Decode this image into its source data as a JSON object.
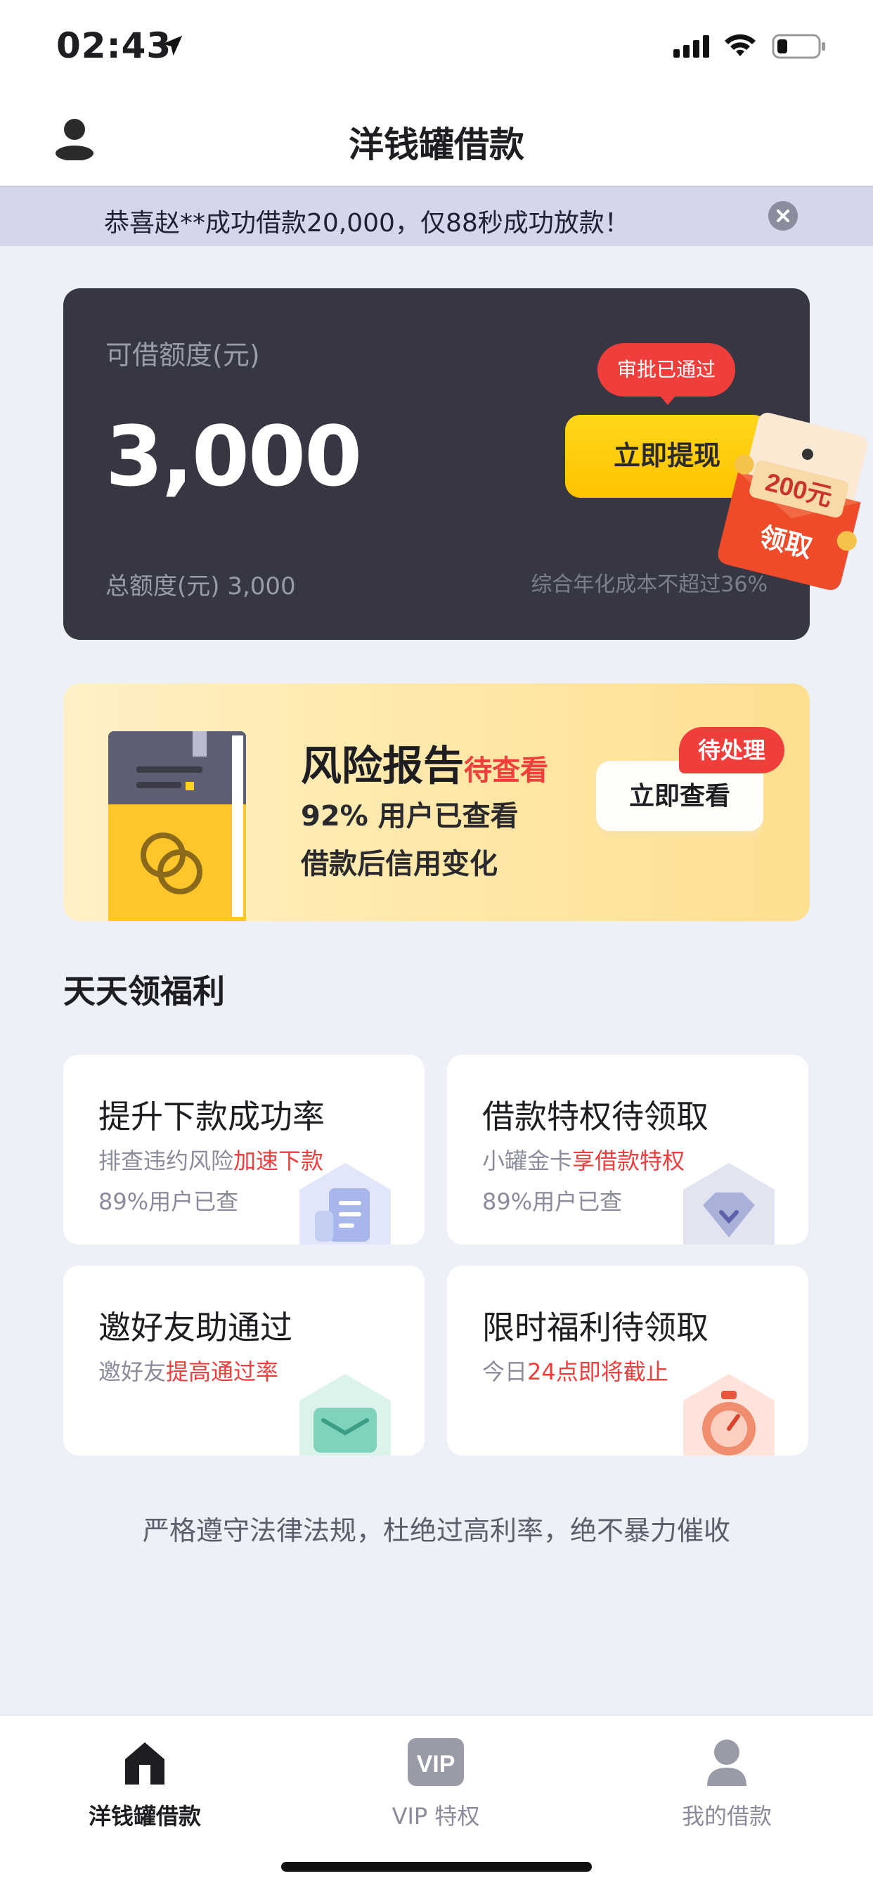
{
  "status_bar": {
    "time": "02:43"
  },
  "header": {
    "title": "洋钱罐借款"
  },
  "notice": {
    "text": "恭喜赵**成功借款20,000，仅88秒成功放款！"
  },
  "credit": {
    "label": "可借额度(元)",
    "amount": "3,000",
    "total_label": "总额度(元) 3,000",
    "rate_note": "综合年化成本不超过36%",
    "approval_badge": "审批已通过",
    "withdraw_button": "立即提现",
    "coupon_amount": "200元",
    "coupon_action": "领取"
  },
  "risk_report": {
    "title": "风险报告",
    "status": "待查看",
    "line1": "92% 用户已查看",
    "line2": "借款后信用变化",
    "button": "立即查看",
    "tag": "待处理"
  },
  "welfare": {
    "section_title": "天天领福利",
    "tiles": [
      {
        "title": "提升下款成功率",
        "sub_plain": "排查违约风险",
        "sub_highlight": "加速下款",
        "sub2": "89%用户已查",
        "icon": "document-icon"
      },
      {
        "title": "借款特权待领取",
        "sub_plain": "小罐金卡",
        "sub_highlight": "享借款特权",
        "sub2": "89%用户已查",
        "icon": "diamond-icon"
      },
      {
        "title": "邀好友助通过",
        "sub_plain": "邀好友",
        "sub_highlight": "提高通过率",
        "sub2": "",
        "icon": "envelope-icon"
      },
      {
        "title": "限时福利待领取",
        "sub_plain": "今日",
        "sub_highlight": "24点即将截止",
        "sub2": "",
        "icon": "stopwatch-icon"
      }
    ]
  },
  "footer_note": "严格遵守法律法规，杜绝过高利率，绝不暴力催收",
  "tabbar": {
    "items": [
      {
        "label": "洋钱罐借款",
        "icon": "home-icon",
        "active": true
      },
      {
        "label": "VIP 特权",
        "icon": "vip-icon",
        "active": false
      },
      {
        "label": "我的借款",
        "icon": "person-icon",
        "active": false
      }
    ]
  },
  "colors": {
    "accent_yellow": "#ffc400",
    "alert_red": "#ef3e3c",
    "card_dark": "#363743",
    "background": "#eef0f8"
  }
}
